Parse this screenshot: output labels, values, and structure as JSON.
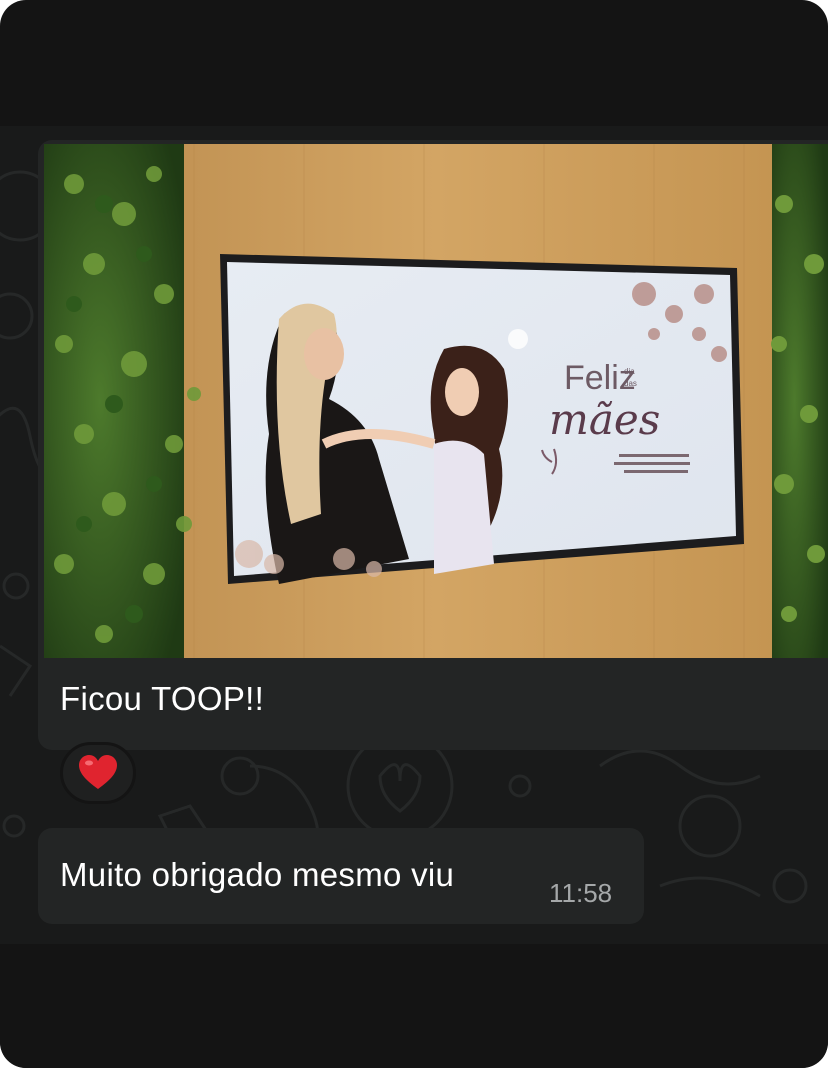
{
  "messages": [
    {
      "type": "image",
      "image_description": "Photo of a TV mounted on a wooden wall between vertical plant walls, showing a Mother's Day greeting",
      "tv_screen": {
        "title_line1": "Feliz",
        "small_words": [
          "dia",
          "das"
        ],
        "title_line2": "mães"
      },
      "caption": "Ficou TOOP!!",
      "reaction": "heart-emoji"
    },
    {
      "type": "text",
      "text": "Muito obrigado mesmo viu",
      "time": "11:58"
    }
  ],
  "colors": {
    "app_background": "#141414",
    "chat_background": "#191a1a",
    "bubble_incoming": "#232525",
    "text_primary": "#ffffff",
    "text_meta": "#a5a8a9",
    "reaction_heart": "#e0242f"
  }
}
